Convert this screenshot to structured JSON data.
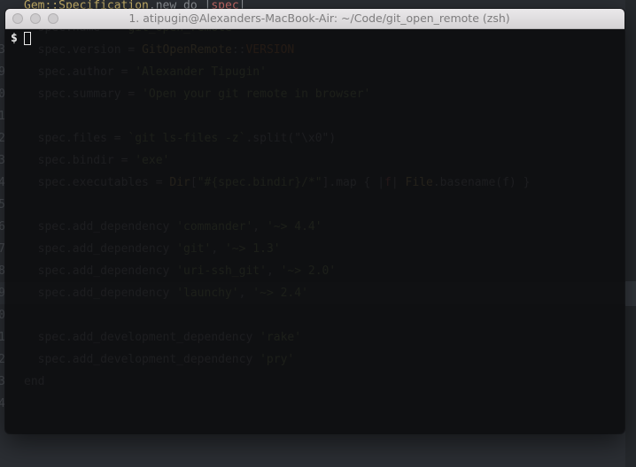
{
  "editor": {
    "lines": [
      {
        "num": "",
        "code": [
          {
            "t": "Gem::Specification",
            "c": "const"
          },
          {
            "t": ".new do |",
            "c": "default"
          },
          {
            "t": "spec",
            "c": "var"
          },
          {
            "t": "|",
            "c": "default"
          }
        ]
      },
      {
        "num": "",
        "code": [
          {
            "t": "  spec.name = ",
            "c": "default"
          },
          {
            "t": "'git_open_remote'",
            "c": "str"
          }
        ]
      },
      {
        "num": "3",
        "code": [
          {
            "t": "  spec.version = ",
            "c": "default"
          },
          {
            "t": "GitOpenRemote",
            "c": "const"
          },
          {
            "t": "::",
            "c": "default"
          },
          {
            "t": "VERSION",
            "c": "kw"
          }
        ]
      },
      {
        "num": "9",
        "code": [
          {
            "t": "  spec.author = ",
            "c": "default"
          },
          {
            "t": "'Alexander Tipugin'",
            "c": "str"
          }
        ]
      },
      {
        "num": "0",
        "code": [
          {
            "t": "  spec.summary = ",
            "c": "default"
          },
          {
            "t": "'Open your git remote in browser'",
            "c": "str"
          }
        ]
      },
      {
        "num": "1",
        "code": []
      },
      {
        "num": "2",
        "code": [
          {
            "t": "  spec.files = ",
            "c": "default"
          },
          {
            "t": "`git ls-files -z`",
            "c": "str"
          },
          {
            "t": ".split(\"\\x0\")",
            "c": "default"
          }
        ]
      },
      {
        "num": "3",
        "code": [
          {
            "t": "  spec.bindir = ",
            "c": "default"
          },
          {
            "t": "'exe'",
            "c": "str"
          }
        ]
      },
      {
        "num": "4",
        "code": [
          {
            "t": "  spec.executables = ",
            "c": "default"
          },
          {
            "t": "Dir",
            "c": "const"
          },
          {
            "t": "[",
            "c": "default"
          },
          {
            "t": "\"#{spec.bindir}/*\"",
            "c": "str"
          },
          {
            "t": "].map { |",
            "c": "default"
          },
          {
            "t": "f",
            "c": "var"
          },
          {
            "t": "| ",
            "c": "default"
          },
          {
            "t": "File",
            "c": "const"
          },
          {
            "t": ".basename(f) }",
            "c": "default"
          }
        ]
      },
      {
        "num": "5",
        "code": []
      },
      {
        "num": "6",
        "code": [
          {
            "t": "  spec.add_dependency ",
            "c": "default"
          },
          {
            "t": "'commander'",
            "c": "str"
          },
          {
            "t": ", ",
            "c": "default"
          },
          {
            "t": "'~> 4.4'",
            "c": "str"
          }
        ]
      },
      {
        "num": "7",
        "code": [
          {
            "t": "  spec.add_dependency ",
            "c": "default"
          },
          {
            "t": "'git'",
            "c": "str"
          },
          {
            "t": ", ",
            "c": "default"
          },
          {
            "t": "'~> 1.3'",
            "c": "str"
          }
        ]
      },
      {
        "num": "8",
        "code": [
          {
            "t": "  spec.add_dependency ",
            "c": "default"
          },
          {
            "t": "'uri-ssh_git'",
            "c": "str"
          },
          {
            "t": ", ",
            "c": "default"
          },
          {
            "t": "'~> 2.0'",
            "c": "str"
          }
        ]
      },
      {
        "num": "9",
        "code": [
          {
            "t": "  spec.add_dependency ",
            "c": "default"
          },
          {
            "t": "'launchy'",
            "c": "str"
          },
          {
            "t": ", ",
            "c": "default"
          },
          {
            "t": "'~> 2.4'",
            "c": "str"
          }
        ],
        "highlight": true
      },
      {
        "num": "0",
        "code": []
      },
      {
        "num": "1",
        "code": [
          {
            "t": "  spec.add_development_dependency ",
            "c": "default"
          },
          {
            "t": "'rake'",
            "c": "str"
          }
        ]
      },
      {
        "num": "2",
        "code": [
          {
            "t": "  spec.add_development_dependency ",
            "c": "default"
          },
          {
            "t": "'pry'",
            "c": "str"
          }
        ]
      },
      {
        "num": "3",
        "code": [
          {
            "t": "end",
            "c": "default"
          }
        ]
      },
      {
        "num": "4",
        "code": []
      }
    ]
  },
  "terminal": {
    "title": "1. atipugin@Alexanders-MacBook-Air: ~/Code/git_open_remote (zsh)",
    "prompt": "$"
  }
}
